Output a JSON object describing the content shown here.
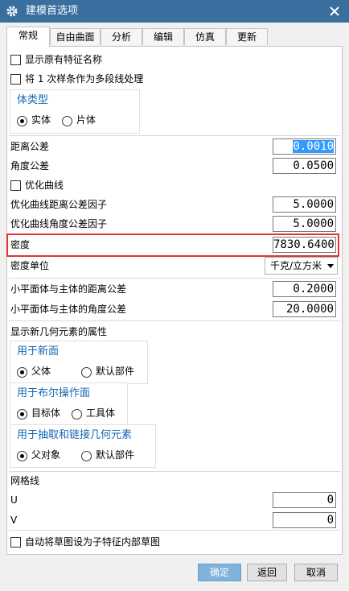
{
  "window": {
    "title": "建模首选项"
  },
  "tabs": [
    {
      "label": "常规"
    },
    {
      "label": "自由曲面"
    },
    {
      "label": "分析"
    },
    {
      "label": "编辑"
    },
    {
      "label": "仿真"
    },
    {
      "label": "更新"
    }
  ],
  "general": {
    "show_original_feature_name": "显示原有特征名称",
    "treat_degree1_splines": "将 1 次样条作为多段线处理",
    "body_type": {
      "title": "体类型",
      "solid": "实体",
      "sheet": "片体",
      "selected": "实体"
    },
    "distance_tolerance": {
      "label": "距离公差",
      "value": "0.0010"
    },
    "angle_tolerance": {
      "label": "角度公差",
      "value": "0.0500"
    },
    "optimize_curves": "优化曲线",
    "opt_curve_distance_factor": {
      "label": "优化曲线距离公差因子",
      "value": "5.0000"
    },
    "opt_curve_angle_factor": {
      "label": "优化曲线角度公差因子",
      "value": "5.0000"
    },
    "density": {
      "label": "密度",
      "value": "7830.6400"
    },
    "density_unit": {
      "label": "密度单位",
      "value": "千克/立方米"
    },
    "small_plane_distance_tol": {
      "label": "小平面体与主体的距离公差",
      "value": "0.2000"
    },
    "small_plane_angle_tol": {
      "label": "小平面体与主体的角度公差",
      "value": "20.0000"
    },
    "show_new_geometry_attrs": "显示新几何元素的属性",
    "for_new_face": {
      "title": "用于新面",
      "opt1": "父体",
      "opt2": "默认部件",
      "selected": "父体"
    },
    "for_boolean_face": {
      "title": "用于布尔操作面",
      "opt1": "目标体",
      "opt2": "工具体",
      "selected": "目标体"
    },
    "for_extract_link": {
      "title": "用于抽取和链接几何元素",
      "opt1": "父对象",
      "opt2": "默认部件",
      "selected": "父对象"
    },
    "grid_lines": {
      "label": "网格线",
      "u_label": "U",
      "u_value": "0",
      "v_label": "V",
      "v_value": "0"
    },
    "auto_set_sketch": "自动将草图设为子特征内部草图"
  },
  "footer": {
    "ok": "确定",
    "back": "返回",
    "cancel": "取消"
  },
  "colors": {
    "titlebar": "#3a6e9e",
    "group_title": "#1467b3",
    "highlight": "#e63232",
    "selection": "#3399ff"
  }
}
